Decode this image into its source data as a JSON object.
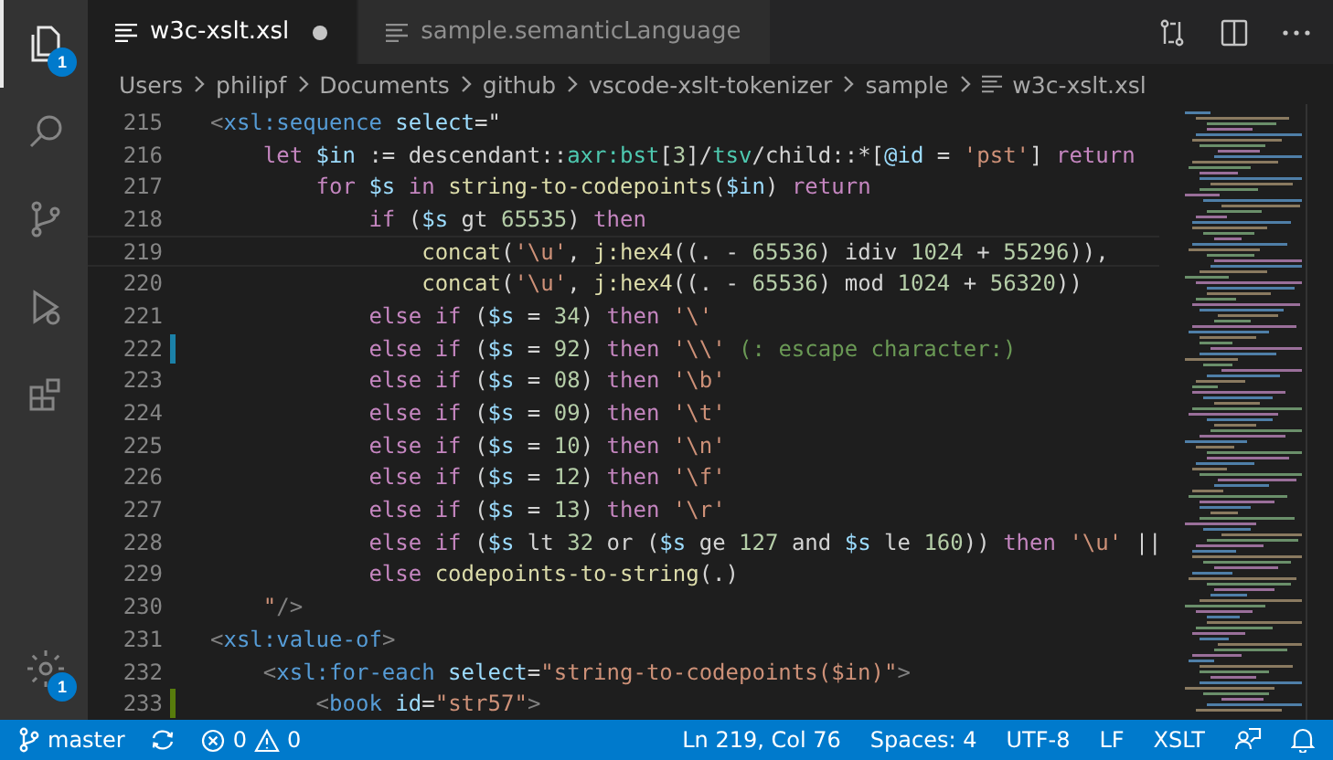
{
  "activity_bar": {
    "items": [
      {
        "kind": "files",
        "selected": true,
        "badge": "1"
      },
      {
        "kind": "search",
        "selected": false
      },
      {
        "kind": "source-control",
        "selected": false
      },
      {
        "kind": "debug",
        "selected": false
      },
      {
        "kind": "extensions",
        "selected": false
      }
    ],
    "manage": {
      "badge": "1"
    }
  },
  "tabs": [
    {
      "label": "w3c-xslt.xsl",
      "selected": true,
      "dirty": true
    },
    {
      "label": "sample.semanticLanguage",
      "selected": false,
      "dirty": false
    }
  ],
  "breadcrumbs": [
    "Users",
    "philipf",
    "Documents",
    "github",
    "vscode-xslt-tokenizer",
    "sample",
    "w3c-xslt.xsl"
  ],
  "editor": {
    "lines": [
      {
        "number": "215",
        "current": false,
        "kind": "unchanged",
        "tokens": [
          {
            "text": "<",
            "kind": "punct"
          },
          {
            "text": "xsl:sequence",
            "kind": "tag"
          },
          {
            "text": " select",
            "kind": "attr"
          },
          {
            "text": "=\"",
            "kind": "text"
          }
        ]
      },
      {
        "number": "216",
        "current": false,
        "kind": "unchanged",
        "tokens": [
          {
            "text": "    let",
            "kind": "keyword"
          },
          {
            "text": " $in",
            "kind": "var"
          },
          {
            "text": " := descendant::",
            "kind": "text"
          },
          {
            "text": "axr:bst",
            "kind": "type"
          },
          {
            "text": "[",
            "kind": "text"
          },
          {
            "text": "3",
            "kind": "number"
          },
          {
            "text": "]/",
            "kind": "text"
          },
          {
            "text": "tsv",
            "kind": "type"
          },
          {
            "text": "/child::*[",
            "kind": "text"
          },
          {
            "text": "@id",
            "kind": "var"
          },
          {
            "text": " = ",
            "kind": "text"
          },
          {
            "text": "'pst'",
            "kind": "string"
          },
          {
            "text": "] ",
            "kind": "text"
          },
          {
            "text": "return",
            "kind": "keyword"
          }
        ]
      },
      {
        "number": "217",
        "current": false,
        "kind": "unchanged",
        "tokens": [
          {
            "text": "        for",
            "kind": "keyword"
          },
          {
            "text": " $s ",
            "kind": "var"
          },
          {
            "text": "in ",
            "kind": "keyword"
          },
          {
            "text": "string-to-codepoints",
            "kind": "function"
          },
          {
            "text": "(",
            "kind": "text"
          },
          {
            "text": "$in",
            "kind": "var"
          },
          {
            "text": ") ",
            "kind": "text"
          },
          {
            "text": "return",
            "kind": "keyword"
          }
        ]
      },
      {
        "number": "218",
        "current": false,
        "kind": "unchanged",
        "tokens": [
          {
            "text": "            if",
            "kind": "keyword"
          },
          {
            "text": " (",
            "kind": "text"
          },
          {
            "text": "$s",
            "kind": "var"
          },
          {
            "text": " gt ",
            "kind": "text"
          },
          {
            "text": "65535",
            "kind": "number"
          },
          {
            "text": ") ",
            "kind": "text"
          },
          {
            "text": "then",
            "kind": "keyword"
          }
        ]
      },
      {
        "number": "219",
        "current": true,
        "kind": "unchanged",
        "tokens": [
          {
            "text": "                concat",
            "kind": "function"
          },
          {
            "text": "(",
            "kind": "text"
          },
          {
            "text": "'\\u'",
            "kind": "string"
          },
          {
            "text": ", ",
            "kind": "text"
          },
          {
            "text": "j:hex4",
            "kind": "function"
          },
          {
            "text": "((. - ",
            "kind": "text"
          },
          {
            "text": "65536",
            "kind": "number"
          },
          {
            "text": ") idiv ",
            "kind": "text"
          },
          {
            "text": "1024",
            "kind": "number"
          },
          {
            "text": " + ",
            "kind": "text"
          },
          {
            "text": "55296",
            "kind": "number"
          },
          {
            "text": ")),",
            "kind": "text"
          }
        ]
      },
      {
        "number": "220",
        "current": false,
        "kind": "unchanged",
        "tokens": [
          {
            "text": "                concat",
            "kind": "function"
          },
          {
            "text": "(",
            "kind": "text"
          },
          {
            "text": "'\\u'",
            "kind": "string"
          },
          {
            "text": ", ",
            "kind": "text"
          },
          {
            "text": "j:hex4",
            "kind": "function"
          },
          {
            "text": "((. - ",
            "kind": "text"
          },
          {
            "text": "65536",
            "kind": "number"
          },
          {
            "text": ") mod ",
            "kind": "text"
          },
          {
            "text": "1024",
            "kind": "number"
          },
          {
            "text": " + ",
            "kind": "text"
          },
          {
            "text": "56320",
            "kind": "number"
          },
          {
            "text": "))",
            "kind": "text"
          }
        ]
      },
      {
        "number": "221",
        "current": false,
        "kind": "unchanged",
        "tokens": [
          {
            "text": "            else if",
            "kind": "keyword"
          },
          {
            "text": " (",
            "kind": "text"
          },
          {
            "text": "$s",
            "kind": "var"
          },
          {
            "text": " = ",
            "kind": "text"
          },
          {
            "text": "34",
            "kind": "number"
          },
          {
            "text": ") ",
            "kind": "text"
          },
          {
            "text": "then ",
            "kind": "keyword"
          },
          {
            "text": "'\\'",
            "kind": "string"
          }
        ]
      },
      {
        "number": "222",
        "current": false,
        "kind": "modified",
        "tokens": [
          {
            "text": "            else if",
            "kind": "keyword"
          },
          {
            "text": " (",
            "kind": "text"
          },
          {
            "text": "$s",
            "kind": "var"
          },
          {
            "text": " = ",
            "kind": "text"
          },
          {
            "text": "92",
            "kind": "number"
          },
          {
            "text": ") ",
            "kind": "text"
          },
          {
            "text": "then ",
            "kind": "keyword"
          },
          {
            "text": "'\\\\'",
            "kind": "string"
          },
          {
            "text": " (: escape character:)",
            "kind": "comment"
          }
        ]
      },
      {
        "number": "223",
        "current": false,
        "kind": "unchanged",
        "tokens": [
          {
            "text": "            else if",
            "kind": "keyword"
          },
          {
            "text": " (",
            "kind": "text"
          },
          {
            "text": "$s",
            "kind": "var"
          },
          {
            "text": " = ",
            "kind": "text"
          },
          {
            "text": "08",
            "kind": "number"
          },
          {
            "text": ") ",
            "kind": "text"
          },
          {
            "text": "then ",
            "kind": "keyword"
          },
          {
            "text": "'\\b'",
            "kind": "string"
          }
        ]
      },
      {
        "number": "224",
        "current": false,
        "kind": "unchanged",
        "tokens": [
          {
            "text": "            else if",
            "kind": "keyword"
          },
          {
            "text": " (",
            "kind": "text"
          },
          {
            "text": "$s",
            "kind": "var"
          },
          {
            "text": " = ",
            "kind": "text"
          },
          {
            "text": "09",
            "kind": "number"
          },
          {
            "text": ") ",
            "kind": "text"
          },
          {
            "text": "then ",
            "kind": "keyword"
          },
          {
            "text": "'\\t'",
            "kind": "string"
          }
        ]
      },
      {
        "number": "225",
        "current": false,
        "kind": "unchanged",
        "tokens": [
          {
            "text": "            else if",
            "kind": "keyword"
          },
          {
            "text": " (",
            "kind": "text"
          },
          {
            "text": "$s",
            "kind": "var"
          },
          {
            "text": " = ",
            "kind": "text"
          },
          {
            "text": "10",
            "kind": "number"
          },
          {
            "text": ") ",
            "kind": "text"
          },
          {
            "text": "then ",
            "kind": "keyword"
          },
          {
            "text": "'\\n'",
            "kind": "string"
          }
        ]
      },
      {
        "number": "226",
        "current": false,
        "kind": "unchanged",
        "tokens": [
          {
            "text": "            else if",
            "kind": "keyword"
          },
          {
            "text": " (",
            "kind": "text"
          },
          {
            "text": "$s",
            "kind": "var"
          },
          {
            "text": " = ",
            "kind": "text"
          },
          {
            "text": "12",
            "kind": "number"
          },
          {
            "text": ") ",
            "kind": "text"
          },
          {
            "text": "then ",
            "kind": "keyword"
          },
          {
            "text": "'\\f'",
            "kind": "string"
          }
        ]
      },
      {
        "number": "227",
        "current": false,
        "kind": "unchanged",
        "tokens": [
          {
            "text": "            else if",
            "kind": "keyword"
          },
          {
            "text": " (",
            "kind": "text"
          },
          {
            "text": "$s",
            "kind": "var"
          },
          {
            "text": " = ",
            "kind": "text"
          },
          {
            "text": "13",
            "kind": "number"
          },
          {
            "text": ") ",
            "kind": "text"
          },
          {
            "text": "then ",
            "kind": "keyword"
          },
          {
            "text": "'\\r'",
            "kind": "string"
          }
        ]
      },
      {
        "number": "228",
        "current": false,
        "kind": "unchanged",
        "tokens": [
          {
            "text": "            else if",
            "kind": "keyword"
          },
          {
            "text": " (",
            "kind": "text"
          },
          {
            "text": "$s",
            "kind": "var"
          },
          {
            "text": " lt ",
            "kind": "text"
          },
          {
            "text": "32",
            "kind": "number"
          },
          {
            "text": " or (",
            "kind": "text"
          },
          {
            "text": "$s",
            "kind": "var"
          },
          {
            "text": " ge ",
            "kind": "text"
          },
          {
            "text": "127",
            "kind": "number"
          },
          {
            "text": " and ",
            "kind": "text"
          },
          {
            "text": "$s",
            "kind": "var"
          },
          {
            "text": " le ",
            "kind": "text"
          },
          {
            "text": "160",
            "kind": "number"
          },
          {
            "text": ")) ",
            "kind": "text"
          },
          {
            "text": "then ",
            "kind": "keyword"
          },
          {
            "text": "'\\u'",
            "kind": "string"
          },
          {
            "text": " ||",
            "kind": "text"
          }
        ]
      },
      {
        "number": "229",
        "current": false,
        "kind": "unchanged",
        "tokens": [
          {
            "text": "            else ",
            "kind": "keyword"
          },
          {
            "text": "codepoints-to-string",
            "kind": "function"
          },
          {
            "text": "(.)",
            "kind": "text"
          }
        ]
      },
      {
        "number": "230",
        "current": false,
        "kind": "unchanged",
        "tokens": [
          {
            "text": "    \"",
            "kind": "string"
          },
          {
            "text": "/>",
            "kind": "punct"
          }
        ]
      },
      {
        "number": "231",
        "current": false,
        "kind": "unchanged",
        "tokens": [
          {
            "text": "<",
            "kind": "punct"
          },
          {
            "text": "xsl:value-of",
            "kind": "tag"
          },
          {
            "text": ">",
            "kind": "punct"
          }
        ]
      },
      {
        "number": "232",
        "current": false,
        "kind": "unchanged",
        "tokens": [
          {
            "text": "    <",
            "kind": "punct"
          },
          {
            "text": "xsl:for-each",
            "kind": "tag"
          },
          {
            "text": " select",
            "kind": "attr"
          },
          {
            "text": "=",
            "kind": "text"
          },
          {
            "text": "\"string-to-codepoints($in)\"",
            "kind": "string"
          },
          {
            "text": ">",
            "kind": "punct"
          }
        ]
      },
      {
        "number": "233",
        "current": false,
        "kind": "added",
        "tokens": [
          {
            "text": "        <",
            "kind": "punct"
          },
          {
            "text": "book",
            "kind": "tag"
          },
          {
            "text": " id",
            "kind": "attr"
          },
          {
            "text": "=",
            "kind": "text"
          },
          {
            "text": "\"str57\"",
            "kind": "string"
          },
          {
            "text": ">",
            "kind": "punct"
          }
        ]
      }
    ]
  },
  "status_bar": {
    "branch": "master",
    "errors": "0",
    "warnings": "0",
    "position": "Ln 219, Col 76",
    "indentation": "Spaces: 4",
    "encoding": "UTF-8",
    "line_ending": "LF",
    "language": "XSLT"
  }
}
